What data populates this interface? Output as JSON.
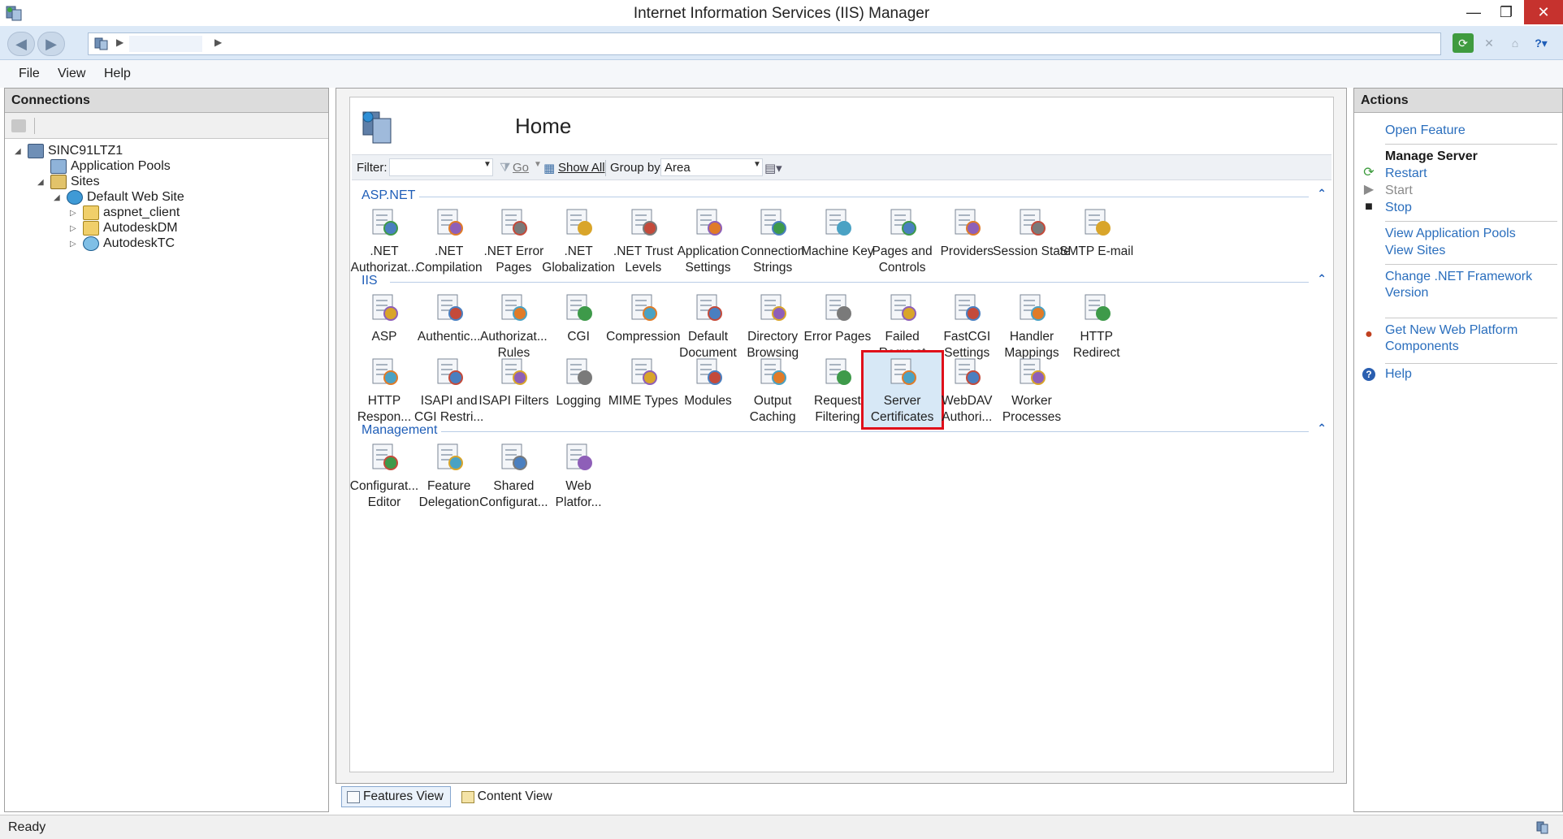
{
  "window": {
    "title": "Internet Information Services (IIS) Manager",
    "min_glyph": "—",
    "max_glyph": "❐",
    "close_glyph": "✕"
  },
  "menu": {
    "file": "File",
    "view": "View",
    "help": "Help"
  },
  "connections": {
    "header": "Connections",
    "tree": [
      {
        "label": "SINC91LTZ1",
        "icon": "server-icon",
        "expander": "◢"
      },
      {
        "label": "Application Pools",
        "icon": "app-pools-icon",
        "expander": ""
      },
      {
        "label": "Sites",
        "icon": "sites-icon",
        "expander": "◢"
      },
      {
        "label": "Default Web Site",
        "icon": "globe-icon",
        "expander": "◢"
      },
      {
        "label": "aspnet_client",
        "icon": "folder-icon",
        "expander": "▷"
      },
      {
        "label": "AutodeskDM",
        "icon": "folder-app-icon",
        "expander": "▷"
      },
      {
        "label": "AutodeskTC",
        "icon": "globe-app-icon",
        "expander": "▷"
      }
    ]
  },
  "center": {
    "title": "Home",
    "filter": {
      "filter_label": "Filter:",
      "go_label": "Go",
      "show_all_label": "Show All",
      "group_by_label": "Group by:",
      "group_by_value": "Area"
    },
    "groups": [
      {
        "name": "ASP.NET",
        "collapse_glyph": "⌃"
      },
      {
        "name": "IIS",
        "collapse_glyph": "⌃"
      },
      {
        "name": "Management",
        "collapse_glyph": "⌃"
      }
    ],
    "aspnet_features": [
      {
        "label": ".NET\nAuthorizat...",
        "icon": "lock-document-icon"
      },
      {
        "label": ".NET\nCompilation",
        "icon": "compilation-icon"
      },
      {
        "label": ".NET Error\nPages",
        "icon": "error-404-icon"
      },
      {
        "label": ".NET\nGlobalization",
        "icon": "globe-stand-icon"
      },
      {
        "label": ".NET Trust\nLevels",
        "icon": "trust-globe-icon"
      },
      {
        "label": "Application\nSettings",
        "icon": "settings-list-icon"
      },
      {
        "label": "Connection\nStrings",
        "icon": "database-ab-icon"
      },
      {
        "label": "Machine Key",
        "icon": "machine-key-icon"
      },
      {
        "label": "Pages and\nControls",
        "icon": "pages-controls-icon"
      },
      {
        "label": "Providers",
        "icon": "providers-icon"
      },
      {
        "label": "Session State",
        "icon": "session-user-icon"
      },
      {
        "label": "SMTP E-mail",
        "icon": "smtp-mail-icon"
      }
    ],
    "iis_features": [
      {
        "label": "ASP",
        "icon": "asp-gear-icon"
      },
      {
        "label": "Authentic...",
        "icon": "authentication-users-icon"
      },
      {
        "label": "Authorizat...\nRules",
        "icon": "authorization-lock-icon"
      },
      {
        "label": "CGI",
        "icon": "cgi-icon"
      },
      {
        "label": "Compression",
        "icon": "compression-clamp-icon"
      },
      {
        "label": "Default\nDocument",
        "icon": "default-document-icon"
      },
      {
        "label": "Directory\nBrowsing",
        "icon": "directory-browsing-icon"
      },
      {
        "label": "Error Pages",
        "icon": "error-pages-icon"
      },
      {
        "label": "Failed\nRequest Tra...",
        "icon": "failed-request-icon"
      },
      {
        "label": "FastCGI\nSettings",
        "icon": "fastcgi-icon"
      },
      {
        "label": "Handler\nMappings",
        "icon": "handler-arrows-icon"
      },
      {
        "label": "HTTP\nRedirect",
        "icon": "http-redirect-icon"
      },
      {
        "label": "HTTP\nRespon...",
        "icon": "http-response-icon"
      },
      {
        "label": "ISAPI and\nCGI Restri...",
        "icon": "isapi-cgi-icon"
      },
      {
        "label": "ISAPI Filters",
        "icon": "isapi-filter-icon"
      },
      {
        "label": "Logging",
        "icon": "logging-book-icon"
      },
      {
        "label": "MIME Types",
        "icon": "mime-types-icon"
      },
      {
        "label": "Modules",
        "icon": "modules-icon"
      },
      {
        "label": "Output\nCaching",
        "icon": "output-caching-icon"
      },
      {
        "label": "Request\nFiltering",
        "icon": "request-filter-icon"
      },
      {
        "label": "Server\nCertificates",
        "icon": "certificates-icon",
        "selected": true
      },
      {
        "label": "WebDAV\nAuthori...",
        "icon": "webdav-icon"
      },
      {
        "label": "Worker\nProcesses",
        "icon": "worker-process-icon"
      }
    ],
    "management_features": [
      {
        "label": "Configurat...\nEditor",
        "icon": "config-editor-icon"
      },
      {
        "label": "Feature\nDelegation",
        "icon": "feature-delegation-icon"
      },
      {
        "label": "Shared\nConfigurat...",
        "icon": "shared-config-icon"
      },
      {
        "label": "Web\nPlatfor...",
        "icon": "web-platform-icon"
      }
    ],
    "tabs": {
      "features_view": "Features View",
      "content_view": "Content View"
    }
  },
  "actions": {
    "header": "Actions",
    "open_feature": "Open Feature",
    "manage_server": "Manage Server",
    "restart": "Restart",
    "start": "Start",
    "stop": "Stop",
    "view_app_pools": "View Application Pools",
    "view_sites": "View Sites",
    "change_net_framework": "Change .NET Framework Version",
    "get_new_web_platform": "Get New Web Platform Components",
    "help": "Help"
  },
  "status": {
    "text": "Ready"
  },
  "colors": {
    "accent": "#2a6ebd",
    "selection_outline": "#e0101a",
    "close_button": "#c6322e",
    "group_header": "#1f5eb8"
  }
}
